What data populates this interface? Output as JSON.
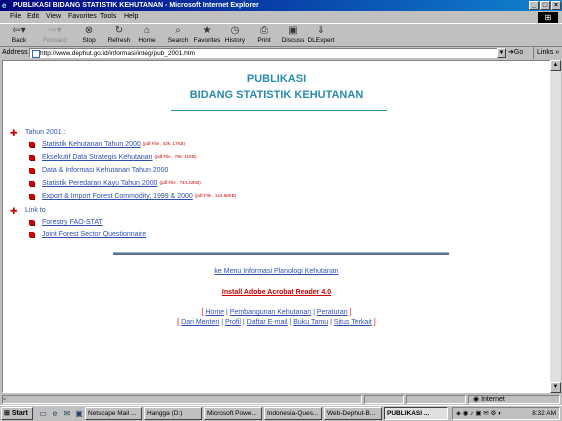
{
  "window": {
    "title": "PUBLIKASI BIDANG STATISTIK KEHUTANAN - Microsoft Internet Explorer"
  },
  "menu": [
    "File",
    "Edit",
    "View",
    "Favorites",
    "Tools",
    "Help"
  ],
  "toolbar": {
    "back": "Back",
    "forward": "Forward",
    "stop": "Stop",
    "refresh": "Refresh",
    "home": "Home",
    "search": "Search",
    "favorites": "Favorites",
    "history": "History",
    "print": "Print",
    "discuss": "Discuss",
    "dlexpert": "DLExpert"
  },
  "address": {
    "label": "Address",
    "url": "http://www.dephut.go.id/informasi/integ/pub_2001.htm",
    "go": "Go",
    "links": "Links"
  },
  "page": {
    "title_line1": "PUBLIKASI",
    "title_line2": "BIDANG STATISTIK KEHUTANAN",
    "section_2001": "Tahun 2001 :",
    "items_2001": [
      {
        "label": "Statistik Kehutanan Tahun 2000",
        "size": "(pdf File , 43k. 17KB)"
      },
      {
        "label": "Eksekutif Data Strategis Kehutanan",
        "size": "(pdf File , 79k. 11KB)"
      },
      {
        "label": "Data & Informasi Kehutanan Tahun 2000",
        "size": ""
      },
      {
        "label": "Statistik Peredaran Kayu Tahun 2000",
        "size": "(pdf File , 744.42KB)"
      },
      {
        "label": "Export & Import Forest Commodity, 1999 & 2000",
        "size": "(pdf File , 144.88KB)"
      }
    ],
    "section_link": "Link to",
    "items_link": [
      "Forestry FAO-STAT",
      "Joint Forest Sector Questionnaire"
    ],
    "back_link": "ke Menu Informasi Planologi Kehutanan",
    "acrobat_link": "Install Adobe Acrobat Reader 4.0",
    "nav1": [
      "Home",
      "Pembangunan Kehutanan",
      "Peraturan"
    ],
    "nav2": [
      "Dari Menteri",
      "Profil",
      "Daftar E-mail",
      "Buku Tamu",
      "Situs Terkait"
    ]
  },
  "status": {
    "zone": "Internet"
  },
  "taskbar": {
    "start": "Start",
    "tasks": [
      "Netscape Mail ...",
      "Hangga (D:)",
      "Microsoft Powe...",
      "Indonesia-Ques...",
      "Web-Dephut-B...",
      "PUBLIKASI ..."
    ],
    "clock": "8:32 AM"
  }
}
